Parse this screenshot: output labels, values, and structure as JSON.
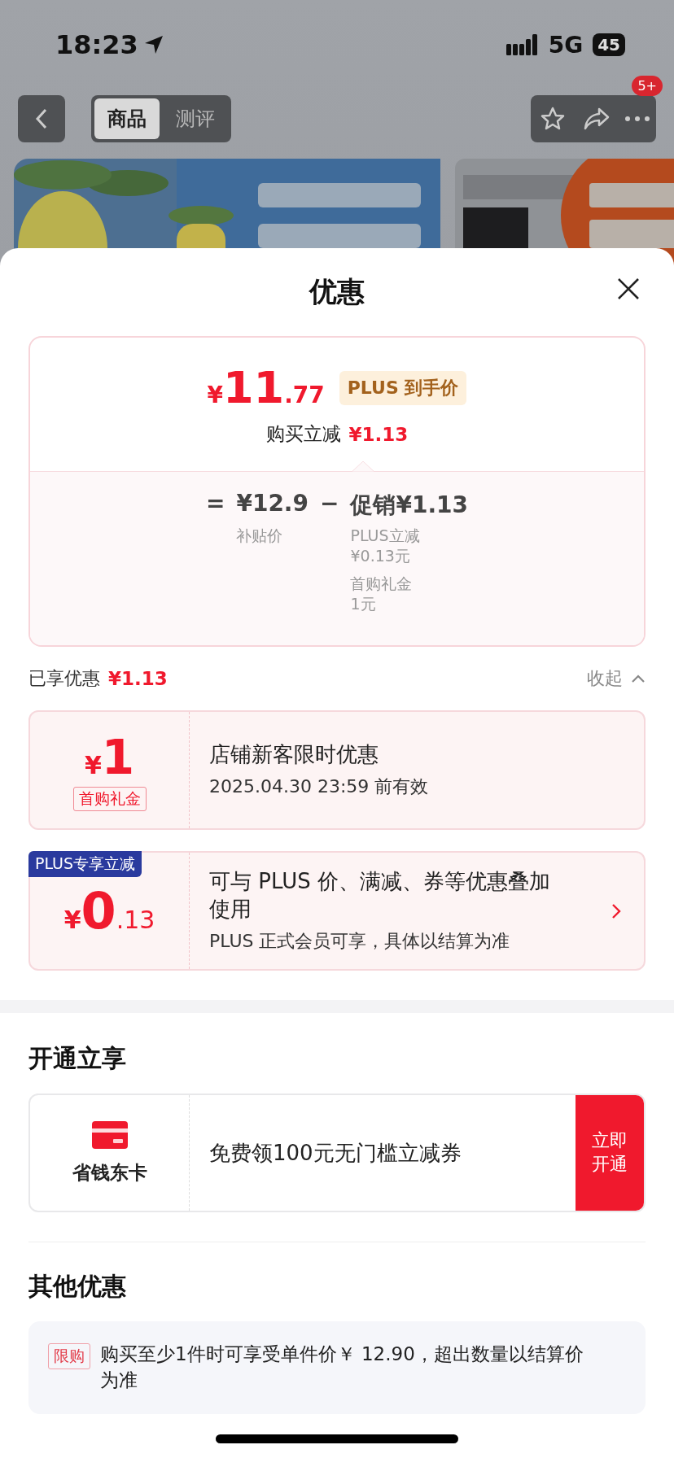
{
  "status_bar": {
    "time": "18:23",
    "network": "5G",
    "battery": "45"
  },
  "nav": {
    "tabs": [
      {
        "label": "商品",
        "selected": true
      },
      {
        "label": "测评",
        "selected": false
      }
    ],
    "badge": "5+"
  },
  "sheet": {
    "title": "优惠"
  },
  "price_card": {
    "symbol": "¥",
    "integer": "11",
    "decimal": ".77",
    "tag": "PLUS 到手价",
    "reduce_label": "购买立减",
    "reduce_amount": "¥1.13",
    "equals": "=",
    "base_price": "¥12.9",
    "base_label": "补贴价",
    "minus": "−",
    "promo": "促销¥1.13",
    "promo_items": [
      {
        "label": "PLUS立减",
        "amount": "¥0.13元"
      },
      {
        "label": "首购礼金",
        "amount": "1元"
      }
    ]
  },
  "enjoyed": {
    "label": "已享优惠",
    "amount": "¥1.13",
    "toggle": "收起",
    "expanded": true
  },
  "coupons": [
    {
      "symbol": "¥",
      "integer": "1",
      "tag": "首购礼金",
      "title": "店铺新客限时优惠",
      "subtitle": "2025.04.30 23:59 前有效",
      "link": false
    },
    {
      "ribbon": "PLUS专享立减",
      "symbol": "¥",
      "integer": "0",
      "decimal": ".13",
      "title": "可与 PLUS 价、满减、券等优惠叠加使用",
      "subtitle": "PLUS 正式会员可享，具体以结算为准",
      "link": true
    }
  ],
  "open_section": {
    "title": "开通立享",
    "card_name": "省钱东卡",
    "text": "免费领100元无门槛立减券",
    "button": "立即开通"
  },
  "other_section": {
    "title": "其他优惠",
    "items": [
      {
        "tag": "限购",
        "text": "购买至少1件时可享受单件价￥ 12.90，超出数量以结算价为准"
      }
    ]
  }
}
